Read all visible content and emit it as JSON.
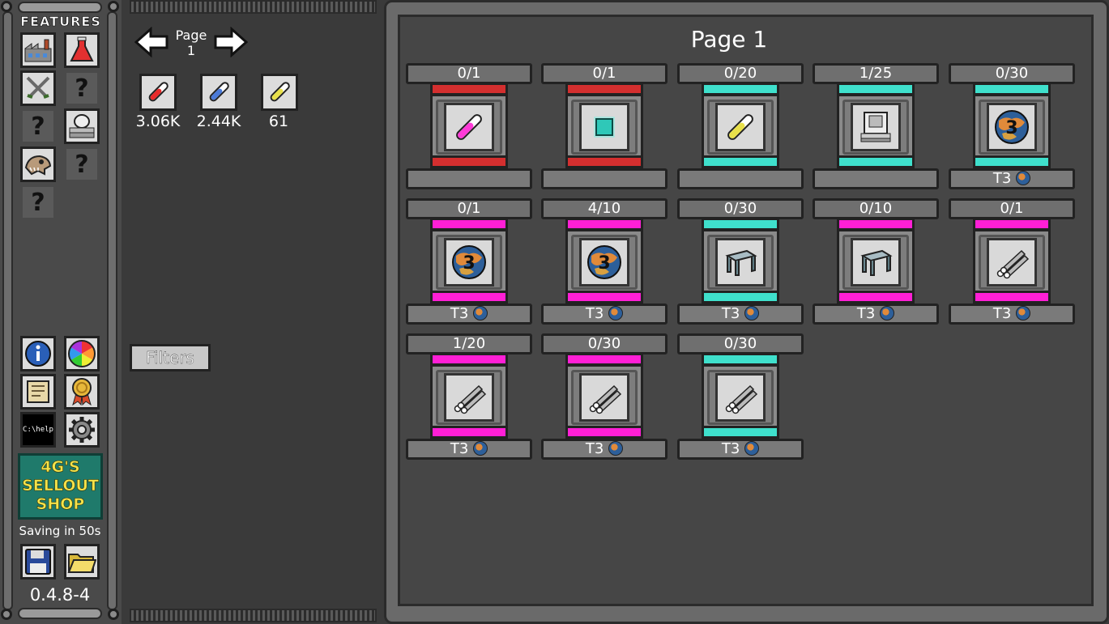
{
  "sidebar": {
    "title": "FEATURES",
    "features": [
      {
        "icon": "factory-icon"
      },
      {
        "icon": "flask-icon"
      },
      {
        "icon": "crossed-swords-icon"
      },
      {
        "icon": "question-icon",
        "label": "?"
      },
      {
        "icon": "question-icon",
        "label": "?"
      },
      {
        "icon": "printer-icon"
      },
      {
        "icon": "dinosaur-skull-icon"
      },
      {
        "icon": "question-icon",
        "label": "?"
      },
      {
        "icon": "question-icon",
        "label": "?"
      }
    ],
    "tools": [
      {
        "icon": "info-icon"
      },
      {
        "icon": "color-wheel-icon"
      },
      {
        "icon": "scroll-map-icon"
      },
      {
        "icon": "award-ribbon-icon"
      },
      {
        "icon": "terminal-help-icon",
        "label": "C:\\help"
      },
      {
        "icon": "gear-icon"
      }
    ],
    "shop_label": [
      "4G'S",
      "SELLOUT",
      "SHOP"
    ],
    "saving_text": "Saving in 50s",
    "version": "0.4.8-4"
  },
  "nav": {
    "page_label": "Page",
    "page_number": "1"
  },
  "resources": [
    {
      "color": "#e82a2a",
      "value": "3.06K"
    },
    {
      "color": "#4a7ad8",
      "value": "2.44K"
    },
    {
      "color": "#e8e04a",
      "value": "61"
    }
  ],
  "filters_label": "Filters",
  "page_title": "Page 1",
  "colors": {
    "red": "#d42f2f",
    "cyan": "#3fe0cc",
    "magenta": "#ff1fd6"
  },
  "cards": [
    {
      "count": "0/1",
      "bar": "red",
      "icon": "pink-vial-icon",
      "footer": ""
    },
    {
      "count": "0/1",
      "bar": "red",
      "icon": "cyan-cube-icon",
      "footer": ""
    },
    {
      "count": "0/20",
      "bar": "cyan",
      "icon": "yellow-vial-icon",
      "footer": ""
    },
    {
      "count": "1/25",
      "bar": "cyan",
      "icon": "machine-icon",
      "footer": ""
    },
    {
      "count": "0/30",
      "bar": "cyan",
      "icon": "planet-3-icon",
      "footer": "T3"
    },
    {
      "count": "0/1",
      "bar": "magenta",
      "icon": "planet-3-icon",
      "footer": "T3"
    },
    {
      "count": "4/10",
      "bar": "magenta",
      "icon": "planet-3-icon",
      "footer": "T3"
    },
    {
      "count": "0/30",
      "bar": "cyan",
      "icon": "metal-plate-icon",
      "footer": "T3"
    },
    {
      "count": "0/10",
      "bar": "magenta",
      "icon": "metal-plate-icon",
      "footer": "T3"
    },
    {
      "count": "0/1",
      "bar": "magenta",
      "icon": "pipes-icon",
      "footer": "T3"
    },
    {
      "count": "1/20",
      "bar": "magenta",
      "icon": "pipes-icon",
      "footer": "T3"
    },
    {
      "count": "0/30",
      "bar": "magenta",
      "icon": "pipes-icon",
      "footer": "T3"
    },
    {
      "count": "0/30",
      "bar": "cyan",
      "icon": "pipes-icon",
      "footer": "T3"
    }
  ]
}
